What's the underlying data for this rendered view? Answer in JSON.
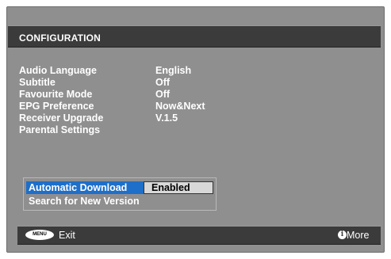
{
  "header": {
    "title": "CONFIGURATION"
  },
  "menu": {
    "items": [
      {
        "label": "Audio Language",
        "value": "English"
      },
      {
        "label": "Subtitle",
        "value": "Off"
      },
      {
        "label": "Favourite Mode",
        "value": "Off"
      },
      {
        "label": "EPG Preference",
        "value": "Now&Next"
      },
      {
        "label": "Receiver Upgrade",
        "value": "V.1.5"
      },
      {
        "label": "Parental Settings",
        "value": ""
      }
    ]
  },
  "download": {
    "label": "Automatic Download",
    "value": "Enabled",
    "search_label": "Search for New Version"
  },
  "footer": {
    "menu_key": "MENU",
    "exit_label": "Exit",
    "info_glyph": "i",
    "more_label": "More"
  },
  "colors": {
    "background": "#8f8f8f",
    "bar": "#3b3b3b",
    "highlight": "#1d6fc9",
    "value_box": "#d8d8d8"
  },
  "icons": {
    "menu_key": "menu-remote-key-icon",
    "info": "info-icon"
  }
}
